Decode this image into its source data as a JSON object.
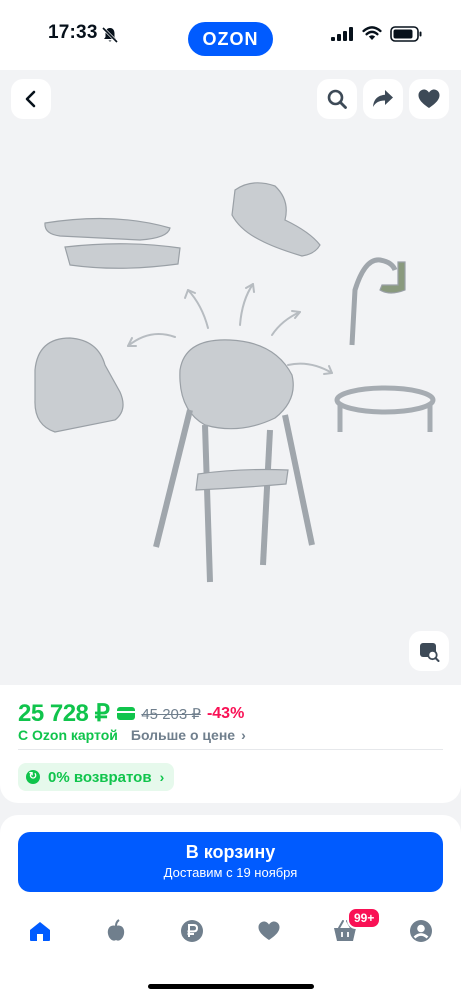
{
  "status_bar": {
    "time": "17:33",
    "logo": "OZON"
  },
  "gallery": {
    "icons": [
      "back-icon",
      "search-icon",
      "share-icon",
      "heart-icon",
      "image-search-icon"
    ]
  },
  "price": {
    "current": "25 728 ₽",
    "old": "45 203 ₽",
    "discount": "-43%",
    "ozon_card_label": "С Ozon картой",
    "more_label": "Больше о цене",
    "chevron": "›"
  },
  "returns": {
    "label": "0% возвратов",
    "chevron": "›"
  },
  "cart": {
    "title": "В корзину",
    "subtitle": "Доставим с 19 ноября"
  },
  "tabbar": {
    "items": [
      "home-icon",
      "fresh-icon",
      "finance-icon",
      "favorites-icon",
      "cart-icon",
      "profile-icon"
    ],
    "cart_badge": "99+"
  },
  "colors": {
    "brand_blue": "#005bff",
    "price_green": "#10c44c",
    "discount_pink": "#f91155"
  }
}
